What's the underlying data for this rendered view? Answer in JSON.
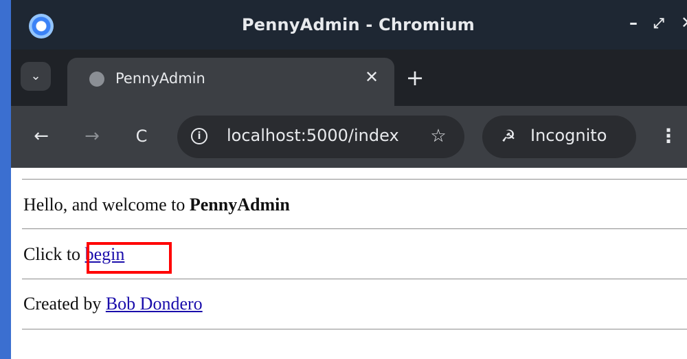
{
  "window": {
    "title": "PennyAdmin - Chromium",
    "controls": {
      "minimize": "–",
      "maximize": "⤢",
      "close": "✕"
    }
  },
  "tabstrip": {
    "search_icon": "chevron-down-icon",
    "tabs": [
      {
        "title": "PennyAdmin",
        "close": "✕",
        "active": true
      }
    ],
    "new_tab": "+"
  },
  "toolbar": {
    "back": "←",
    "forward": "→",
    "reload": "C",
    "url": "localhost:5000/index",
    "bookmark_icon": "☆",
    "incognito_label": "Incognito",
    "menu": "⋮"
  },
  "page": {
    "welcome_prefix": "Hello, and welcome to ",
    "welcome_brand": "PennyAdmin",
    "click_prefix": "Click to ",
    "begin_link": "begin",
    "created_prefix": "Created by ",
    "author_link": "Bob Dondero"
  },
  "colors": {
    "titlebar": "#1e2733",
    "tabstrip": "#1f2227",
    "toolbar": "#3c3f44",
    "link": "#1a0dab",
    "highlight": "#ff0000",
    "window_edge": "#3b6fd0"
  }
}
